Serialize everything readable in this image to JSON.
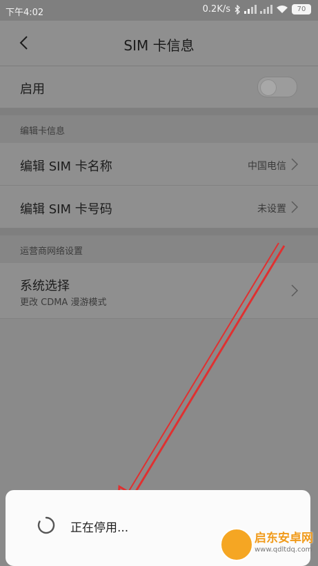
{
  "status_bar": {
    "time": "下午4:02",
    "network_speed": "0.2K/s",
    "battery": "70"
  },
  "header": {
    "title": "SIM  卡信息"
  },
  "enable_row": {
    "label": "启用",
    "enabled": false
  },
  "edit_section": {
    "header": "编辑卡信息",
    "items": [
      {
        "label": "编辑 SIM 卡名称",
        "value": "中国电信"
      },
      {
        "label": "编辑 SIM 卡号码",
        "value": "未设置"
      }
    ]
  },
  "carrier_section": {
    "header": "运营商网络设置",
    "items": [
      {
        "label": "系统选择",
        "subtitle": "更改 CDMA 漫游模式"
      }
    ]
  },
  "toast": {
    "text": "正在停用..."
  },
  "watermark": {
    "title": "启东安卓网",
    "url": "www.qdltdq.com"
  },
  "colors": {
    "overlay_bg": "#8f8f8f",
    "arrow": "#e03030",
    "toast_bg": "#fbfbfb"
  }
}
